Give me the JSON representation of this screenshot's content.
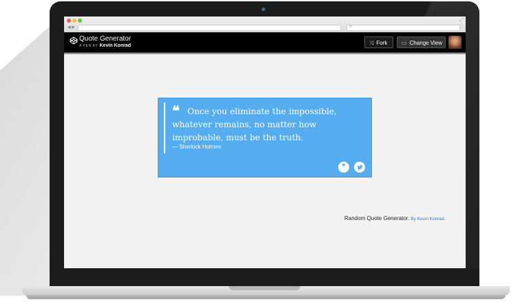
{
  "browser": {
    "nav_arrows": "◀ ▶",
    "url_text": "",
    "search_icon": "⚲",
    "resize_icon": "⤢"
  },
  "codepen": {
    "title": "Quote Generator",
    "byline_prefix": "A PEN BY",
    "author": "Kevin Konrad",
    "fork_label": "Fork",
    "change_view_label": "Change View",
    "icons": {
      "fork": "fork-icon",
      "view": "window-icon",
      "logo": "codepen-logo"
    }
  },
  "quote": {
    "mark": "❝",
    "text": "Once you eliminate the impossible, whatever remains, no matter how improbable, must be the truth.",
    "author": "— Sherlock Holmes",
    "new_quote_icon": "❞",
    "tweet_icon": "t"
  },
  "footer": {
    "text": "Random Quote Generator.",
    "by": "By Kevin Konrad."
  },
  "colors": {
    "quote_bg": "#55acee",
    "header_bg": "#000000",
    "page_bg": "#f2f2f3",
    "link": "#2b78c2"
  }
}
